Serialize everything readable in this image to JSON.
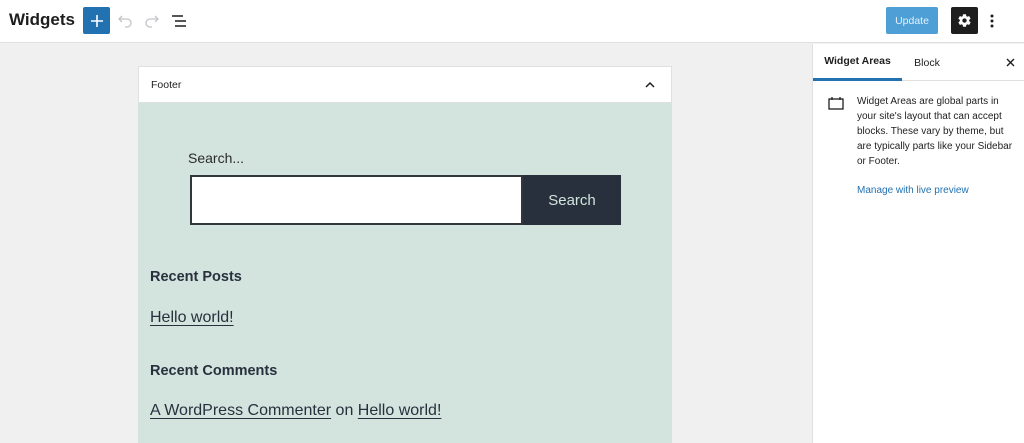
{
  "header": {
    "title": "Widgets",
    "update_label": "Update"
  },
  "footer_area": {
    "title": "Footer",
    "search_label": "Search...",
    "search_input_value": "",
    "search_button_label": "Search",
    "recent_posts_heading": "Recent Posts",
    "recent_posts": [
      "Hello world!"
    ],
    "recent_comments_heading": "Recent Comments",
    "comment": {
      "author": "A WordPress Commenter",
      "connector": "on",
      "post": "Hello world!"
    }
  },
  "sidebar": {
    "tabs": [
      {
        "label": "Widget Areas",
        "active": true
      },
      {
        "label": "Block",
        "active": false
      }
    ],
    "description": "Widget Areas are global parts in your site's layout that can accept blocks. These vary by theme, but are typically parts like your Sidebar or Footer.",
    "manage_link": "Manage with live preview"
  },
  "icons": {
    "add": "plus-icon",
    "undo": "undo-icon",
    "redo": "redo-icon",
    "list_view": "list-view-icon",
    "settings": "gear-icon",
    "more": "more-vertical-icon",
    "collapse": "chevron-up-icon",
    "close": "close-icon",
    "widget_area": "block-default-icon"
  },
  "colors": {
    "accent": "#2271b1",
    "footer_background": "#d3e3de",
    "search_button": "#28303d"
  }
}
